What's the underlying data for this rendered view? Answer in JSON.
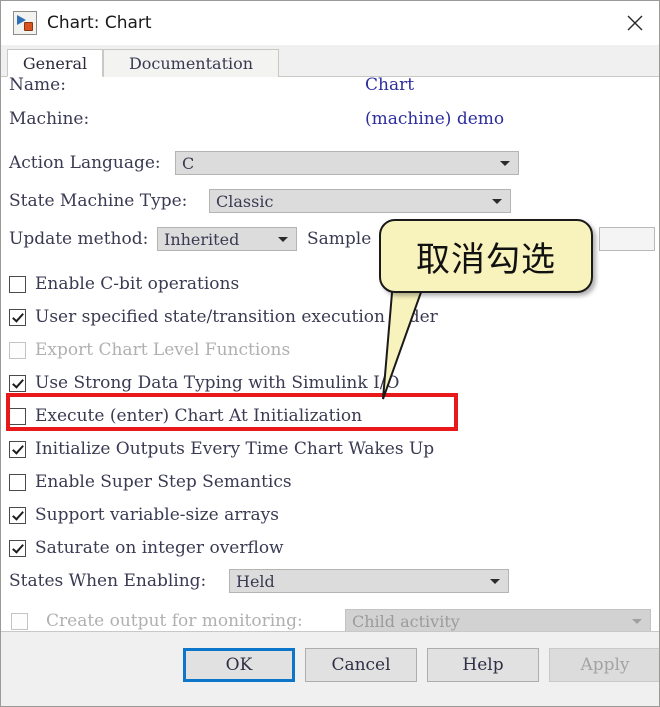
{
  "window": {
    "title": "Chart: Chart",
    "icon": "stateflow-chart-icon",
    "close_label": "close-icon"
  },
  "tabs": [
    {
      "label": "General",
      "selected": true
    },
    {
      "label": "Documentation",
      "selected": false
    }
  ],
  "fields": {
    "name_label": "Name:",
    "name_value": "Chart",
    "machine_label": "Machine:",
    "machine_value": "(machine) demo",
    "action_language_label": "Action Language:",
    "action_language_value": "C",
    "state_machine_type_label": "State Machine Type:",
    "state_machine_type_value": "Classic",
    "update_method_label": "Update method:",
    "update_method_value": "Inherited",
    "sample_time_label": "Sample",
    "sample_time_value": "",
    "states_when_enabling_label": "States When Enabling:",
    "states_when_enabling_value": "Held",
    "create_output_label": "Create output for monitoring:",
    "create_output_value": "Child activity"
  },
  "checkboxes": [
    {
      "label": "Enable C-bit operations",
      "checked": false,
      "disabled": false
    },
    {
      "label": "User specified state/transition execution order",
      "checked": true,
      "disabled": false
    },
    {
      "label": "Export Chart Level Functions",
      "checked": false,
      "disabled": true
    },
    {
      "label": "Use Strong Data Typing with Simulink I/O",
      "checked": true,
      "disabled": false
    },
    {
      "label": "Execute (enter) Chart At Initialization",
      "checked": false,
      "disabled": false
    },
    {
      "label": "Initialize Outputs Every Time Chart Wakes Up",
      "checked": true,
      "disabled": false
    },
    {
      "label": "Enable Super Step Semantics",
      "checked": false,
      "disabled": false
    },
    {
      "label": "Support variable-size arrays",
      "checked": true,
      "disabled": false
    },
    {
      "label": "Saturate on integer overflow",
      "checked": true,
      "disabled": false
    }
  ],
  "annotation": {
    "callout_text": "取消勾选",
    "callout_fill": "#F8F2BD",
    "callout_border": "#1A1A1A",
    "highlight_color": "#E8191B",
    "highlight_target": "Execute (enter) Chart At Initialization"
  },
  "buttons": {
    "ok": "OK",
    "cancel": "Cancel",
    "help": "Help",
    "apply": "Apply"
  }
}
